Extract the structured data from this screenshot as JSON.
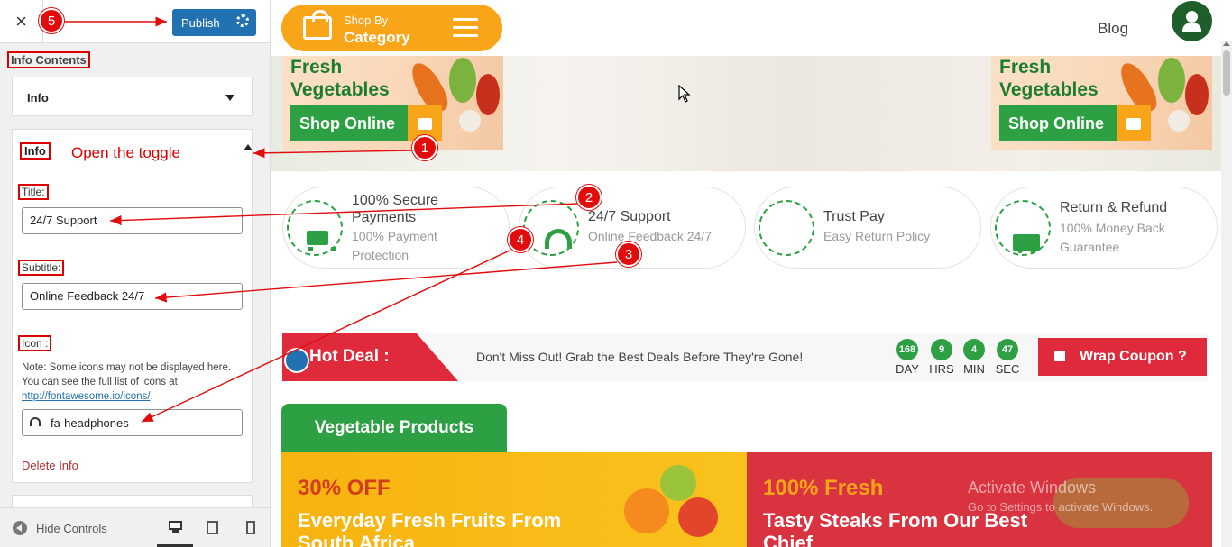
{
  "panel": {
    "close_icon": "×",
    "publish_label": "Publish",
    "heading": "Info Contents",
    "collapsed_item_label": "Info",
    "expanded_item_label": "Info",
    "toggle_hint": "Open the toggle",
    "title_label": "Title:",
    "title_value": "24/7 Support",
    "subtitle_label": "Subtitle:",
    "subtitle_value": "Online Feedback 24/7",
    "icon_label": "Icon :",
    "icon_note": "Note: Some icons may not be displayed here. You can see the full list of icons at ",
    "icon_link": "http://fontawesome.io/icons/",
    "icon_note_end": ".",
    "icon_value": "fa-headphones",
    "delete_label": "Delete Info",
    "hide_controls_label": "Hide Controls"
  },
  "badges": [
    "1",
    "2",
    "3",
    "4",
    "5"
  ],
  "header": {
    "shop_by": "Shop By",
    "category": "Category",
    "blog": "Blog"
  },
  "hero": {
    "left_title": [
      "Fresh",
      "Vegetables"
    ],
    "left_button": "Shop Online",
    "right_title": [
      "Fresh",
      "Vegetables"
    ],
    "right_button": "Shop Online"
  },
  "features": [
    {
      "title": "100% Secure Payments",
      "subtitle": "100% Payment Protection",
      "icon": "cart-icon"
    },
    {
      "title": "24/7 Support",
      "subtitle": "Online Feedback 24/7",
      "icon": "headphones-icon"
    },
    {
      "title": "Trust Pay",
      "subtitle": "Easy Return Policy",
      "icon": "none"
    },
    {
      "title": "Return & Refund",
      "subtitle": "100% Money Back Guarantee",
      "icon": "truck-icon"
    }
  ],
  "hot_deal": {
    "label": "Hot Deal :",
    "message": "Don't Miss Out! Grab the Best Deals Before They're Gone!",
    "countdown": [
      {
        "value": "168",
        "unit": "DAY"
      },
      {
        "value": "9",
        "unit": "HRS"
      },
      {
        "value": "4",
        "unit": "MIN"
      },
      {
        "value": "47",
        "unit": "SEC"
      }
    ],
    "coupon_label": "Wrap Coupon ?"
  },
  "products": {
    "tab_label": "Vegetable Products",
    "promo1_pct": "30% OFF",
    "promo1_head": "Everyday Fresh Fruits From South Africa",
    "promo2_pct": "100% Fresh",
    "promo2_head": "Tasty Steaks From Our Best Chief"
  },
  "watermark": {
    "line1": "Activate Windows",
    "line2": "Go to Settings to activate Windows."
  },
  "colors": {
    "publish_blue": "#2271b1",
    "annotation_red": "#e20c0c",
    "brand_orange": "#f9a51a",
    "brand_green": "#2ca043",
    "deal_red": "#df2a3c"
  }
}
